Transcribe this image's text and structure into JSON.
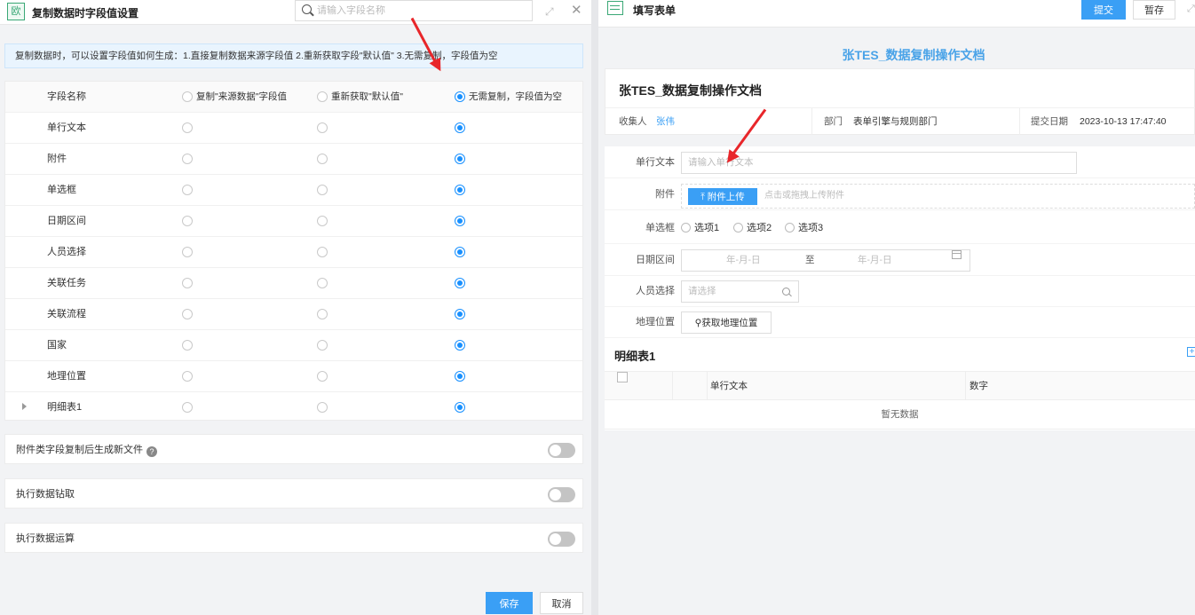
{
  "left_panel": {
    "title": "复制数据时字段值设置",
    "app_icon_text": "欧",
    "search_placeholder": "请输入字段名称",
    "notice": "复制数据时，可以设置字段值如何生成：1.直接复制数据来源字段值 2.重新获取字段\"默认值\" 3.无需复制，字段值为空",
    "table": {
      "header": "字段名称",
      "options": [
        "复制\"来源数据\"字段值",
        "重新获取\"默认值\"",
        "无需复制，字段值为空"
      ],
      "header_selected": 2,
      "rows": [
        {
          "name": "单行文本",
          "selected": 2,
          "expandable": false
        },
        {
          "name": "附件",
          "selected": 2,
          "expandable": false
        },
        {
          "name": "单选框",
          "selected": 2,
          "expandable": false
        },
        {
          "name": "日期区间",
          "selected": 2,
          "expandable": false
        },
        {
          "name": "人员选择",
          "selected": 2,
          "expandable": false
        },
        {
          "name": "关联任务",
          "selected": 2,
          "expandable": false
        },
        {
          "name": "关联流程",
          "selected": 2,
          "expandable": false
        },
        {
          "name": "国家",
          "selected": 2,
          "expandable": false
        },
        {
          "name": "地理位置",
          "selected": 2,
          "expandable": false
        },
        {
          "name": "明细表1",
          "selected": 2,
          "expandable": true
        }
      ]
    },
    "toggles": [
      {
        "label": "附件类字段复制后生成新文件",
        "has_help": true,
        "on": false
      },
      {
        "label": "执行数据钻取",
        "has_help": false,
        "on": false
      },
      {
        "label": "执行数据运算",
        "has_help": false,
        "on": false
      }
    ],
    "save_label": "保存",
    "cancel_label": "取消"
  },
  "right_panel": {
    "title": "填写表单",
    "submit_label": "提交",
    "draft_label": "暂存",
    "doc_title_top": "张TES_数据复制操作文档",
    "doc_title": "张TES_数据复制操作文档",
    "meta": {
      "collector_label": "收集人",
      "collector_value": "张伟",
      "dept_label": "部门",
      "dept_value": "表单引擎与规则部门",
      "date_label": "提交日期",
      "date_value": "2023-10-13 17:47:40"
    },
    "form": {
      "text_label": "单行文本",
      "text_placeholder": "请输入单行文本",
      "attach_label": "附件",
      "upload_button": "附件上传",
      "upload_hint": "点击或拖拽上传附件",
      "radio_label": "单选框",
      "radio_options": [
        "选项1",
        "选项2",
        "选项3"
      ],
      "date_label": "日期区间",
      "date_start": "年-月-日",
      "date_sep": "至",
      "date_end": "年-月-日",
      "person_label": "人员选择",
      "person_placeholder": "请选择",
      "geo_label": "地理位置",
      "geo_button": "获取地理位置"
    },
    "detail_table": {
      "title": "明细表1",
      "columns": [
        "单行文本",
        "数字"
      ],
      "empty_text": "暂无数据"
    }
  },
  "colors": {
    "primary": "#3a9ff5",
    "radio_checked": "#1890ff",
    "annotation_arrow": "#e8262a",
    "doc_title_blue": "#4aa3e8",
    "notice_bg": "#e9f4fe"
  }
}
